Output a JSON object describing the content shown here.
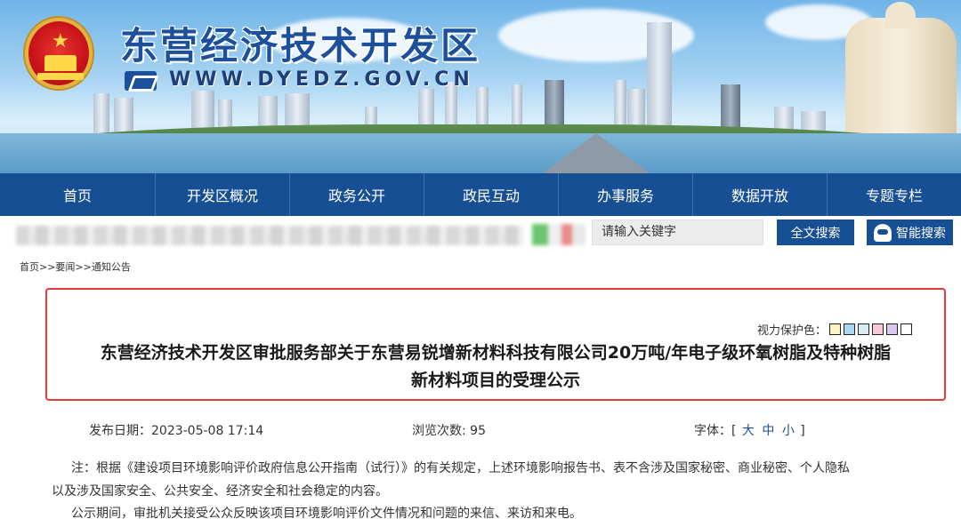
{
  "header": {
    "site_title": "东营经济技术开发区",
    "site_url": "WWW.DYEDZ.GOV.CN"
  },
  "nav": {
    "items": [
      {
        "label": "首页"
      },
      {
        "label": "开发区概况"
      },
      {
        "label": "政务公开"
      },
      {
        "label": "政民互动"
      },
      {
        "label": "办事服务"
      },
      {
        "label": "数据开放"
      },
      {
        "label": "专题专栏"
      }
    ]
  },
  "search": {
    "placeholder": "请输入关键字",
    "full_search_label": "全文搜索",
    "smart_search_label": "智能搜索"
  },
  "breadcrumb": {
    "text": "首页>>要闻>>通知公告"
  },
  "article": {
    "vision_label": "视力保护色：",
    "swatches": [
      "#fdf6c3",
      "#a9d8ef",
      "#d7eef0",
      "#f6c9d6",
      "#d9c8ef",
      "#ffffff"
    ],
    "title_line1": "东营经济技术开发区审批服务部关于东营易锐增新材料科技有限公司20万吨/年电子级环氧树脂及特种树脂",
    "title_line2": "新材料项目的受理公示",
    "publish_date": "发布日期：2023-05-08 17:14",
    "views": "浏览次数: 95",
    "font_label": "字体：[",
    "font_large": "大",
    "font_medium": "中",
    "font_small": "小",
    "font_end": "]",
    "para1_line1": "注：根据《建设项目环境影响评价政府信息公开指南（试行）》的有关规定，上述环境影响报告书、表不含涉及国家秘密、商业秘密、个人隐私",
    "para1_line2": "以及涉及国家安全、公共安全、经济安全和社会稳定的内容。",
    "para2": "公示期间，审批机关接受公众反映该项目环境影响评价文件情况和问题的来信、来访和来电。"
  }
}
